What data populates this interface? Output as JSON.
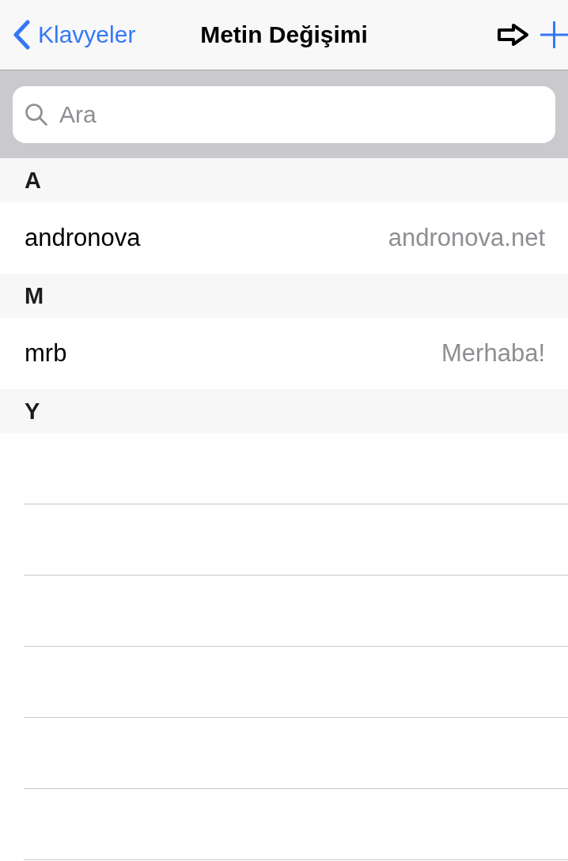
{
  "nav": {
    "back_label": "Klavyeler",
    "title": "Metin Değişimi"
  },
  "search": {
    "placeholder": "Ara"
  },
  "sections": [
    {
      "letter": "A",
      "rows": [
        {
          "phrase": "andronova",
          "shortcut": "andronova.net"
        }
      ]
    },
    {
      "letter": "M",
      "rows": [
        {
          "phrase": "mrb",
          "shortcut": "Merhaba!"
        }
      ]
    },
    {
      "letter": "Y"
    }
  ]
}
